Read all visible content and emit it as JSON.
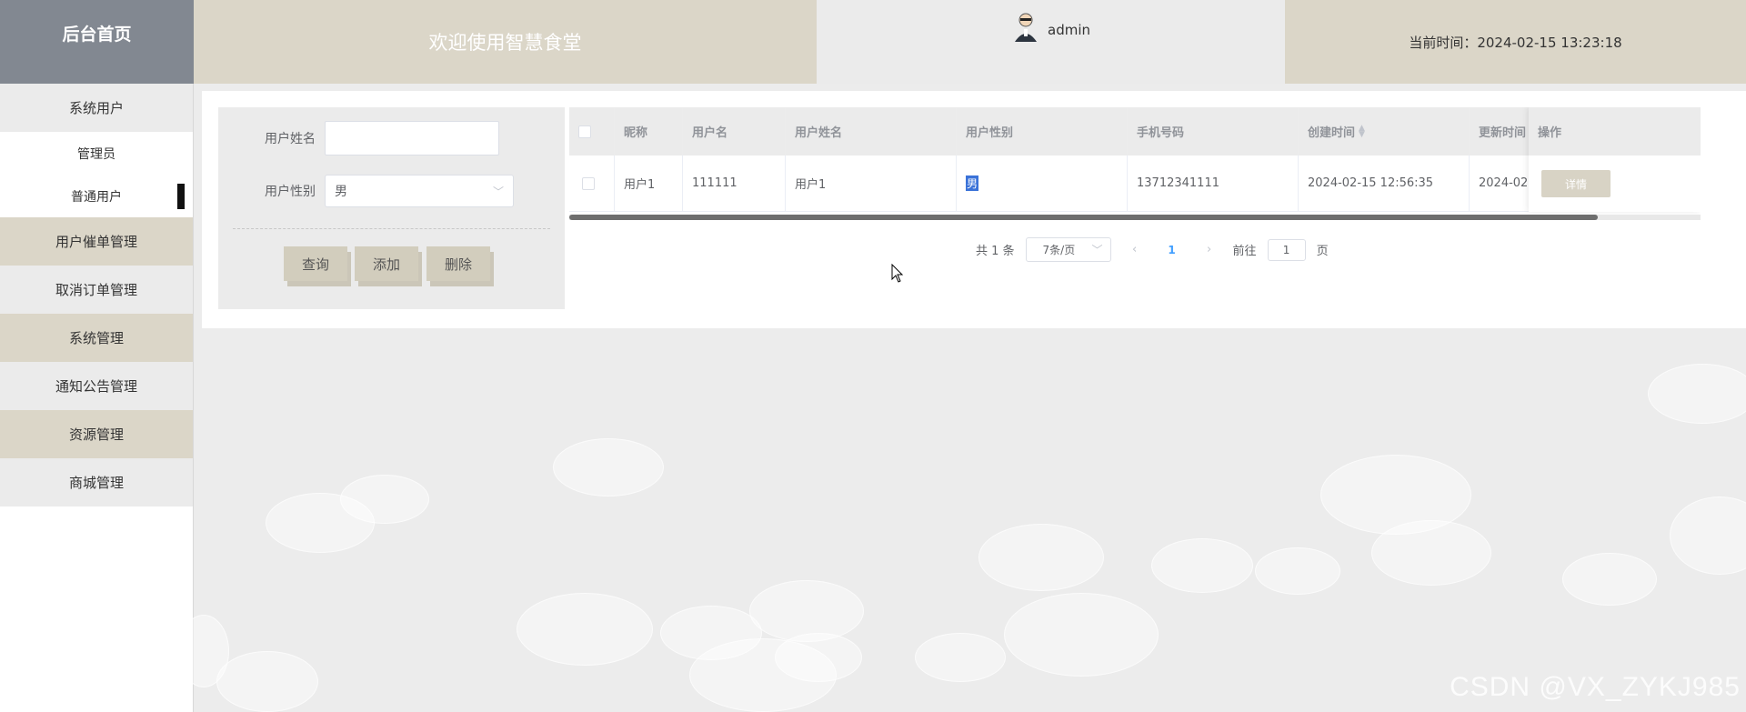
{
  "header": {
    "brand": "后台首页",
    "welcome": "欢迎使用智慧食堂",
    "username": "admin",
    "current_time": "当前时间：2024-02-15 13:23:18"
  },
  "sidebar": {
    "items": [
      {
        "label": "系统用户"
      },
      {
        "label": "管理员"
      },
      {
        "label": "普通用户"
      },
      {
        "label": "用户催单管理"
      },
      {
        "label": "取消订单管理"
      },
      {
        "label": "系统管理"
      },
      {
        "label": "通知公告管理"
      },
      {
        "label": "资源管理"
      },
      {
        "label": "商城管理"
      }
    ]
  },
  "search": {
    "name_label": "用户姓名",
    "name_value": "",
    "gender_label": "用户性别",
    "gender_value": "男",
    "query_label": "查询",
    "add_label": "添加",
    "delete_label": "删除"
  },
  "table": {
    "columns": [
      "昵称",
      "用户名",
      "用户姓名",
      "用户性别",
      "手机号码",
      "创建时间",
      "更新时间",
      "操作"
    ],
    "rows": [
      {
        "nickname": "用户1",
        "username": "111111",
        "realname": "用户1",
        "gender": "男",
        "phone": "13712341111",
        "created": "2024-02-15 12:56:35",
        "updated": "2024-02-",
        "action": "详情"
      }
    ]
  },
  "pagination": {
    "total": "共 1 条",
    "page_size": "7条/页",
    "current_page": "1",
    "goto_label": "前往",
    "goto_value": "1",
    "page_suffix": "页"
  },
  "watermark": "CSDN @VX_ZYKJ985"
}
